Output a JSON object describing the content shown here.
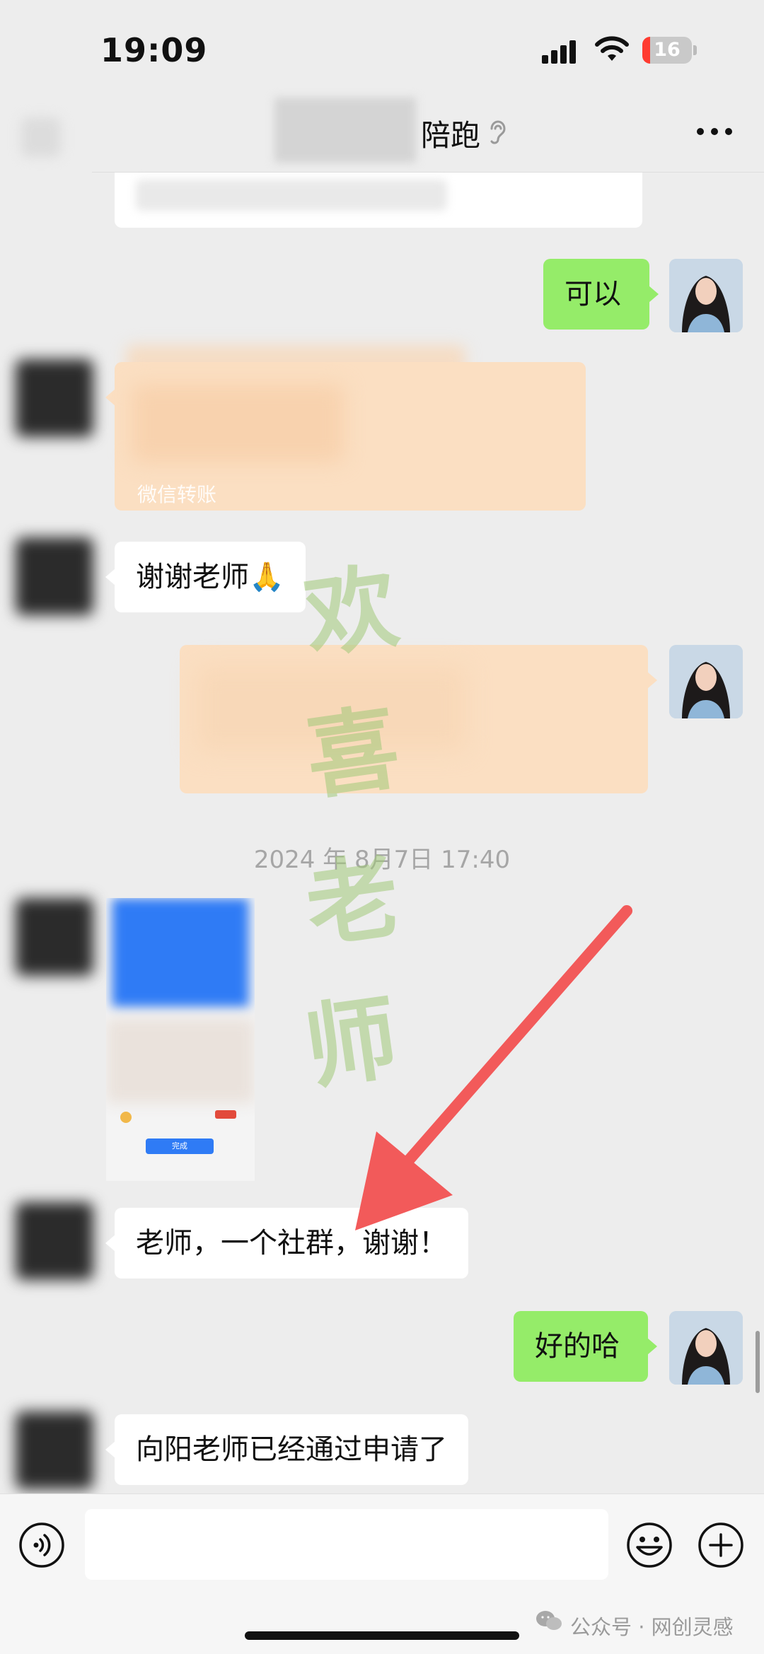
{
  "status_bar": {
    "time": "19:09",
    "battery_level": "16",
    "battery_percent": 16
  },
  "header": {
    "title": "陪跑"
  },
  "messages": {
    "m1_text": "可以",
    "m2_transfer_label": "微信转账",
    "m3_text": "谢谢老师🙏",
    "timestamp": "2024 年 8月7日 17:40",
    "m6_text": "老师，一个社群，谢谢！",
    "m7_text": "好的哈",
    "m8_text": "向阳老师已经通过申请了"
  },
  "watermark": {
    "chars": [
      "欢",
      "喜",
      "老",
      "师"
    ]
  },
  "preview": {
    "button_label": "完成"
  },
  "footer": {
    "source_note": "公众号 · 网创灵感"
  },
  "colors": {
    "sent_bubble": "#95ec69",
    "received_bubble": "#ffffff",
    "transfer_card": "#fbdfc2",
    "arrow": "#f25a5a",
    "background": "#ededed"
  }
}
